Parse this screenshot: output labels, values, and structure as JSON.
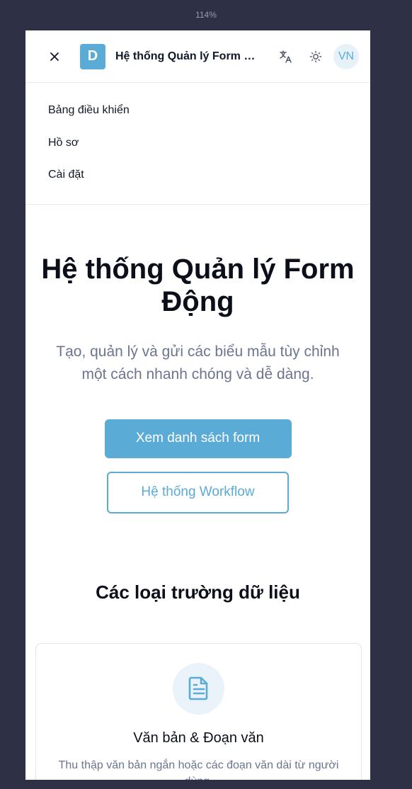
{
  "zoom_level": "114%",
  "header": {
    "logo_letter": "D",
    "app_title": "Hệ thống Quản lý Form Động",
    "avatar_initials": "VN"
  },
  "nav": {
    "items": [
      {
        "label": "Bảng điều khiển"
      },
      {
        "label": "Hồ sơ"
      },
      {
        "label": "Cài đặt"
      }
    ]
  },
  "hero": {
    "title": "Hệ thống Quản lý Form Động",
    "subtitle": "Tạo, quản lý và gửi các biểu mẫu tùy chỉnh một cách nhanh chóng và dễ dàng.",
    "primary_button": "Xem danh sách form",
    "secondary_button": "Hệ thống Workflow"
  },
  "field_types": {
    "title": "Các loại trường dữ liệu",
    "cards": [
      {
        "icon": "document-icon",
        "title": "Văn bản & Đoạn văn",
        "description": "Thu thập văn bản ngắn hoặc các đoạn văn dài từ người dùng."
      }
    ]
  },
  "colors": {
    "accent": "#5aabd6",
    "background": "#2e3045",
    "text_dark": "#0b0f1a",
    "text_muted": "#6b7590"
  }
}
